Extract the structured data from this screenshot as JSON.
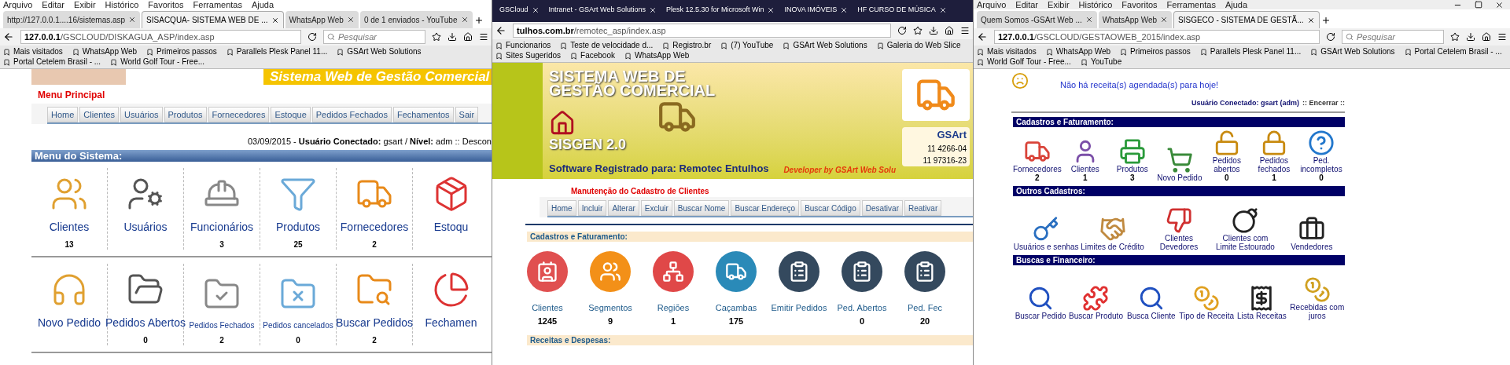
{
  "left": {
    "menu_bar": [
      "Arquivo",
      "Editar",
      "Exibir",
      "Histórico",
      "Favoritos",
      "Ferramentas",
      "Ajuda"
    ],
    "tabs": [
      {
        "label": "http://127.0.0.1....16/sistemas.asp",
        "selected": false
      },
      {
        "label": "SISACQUA- SISTEMA WEB DE ...",
        "selected": true
      },
      {
        "label": "WhatsApp Web",
        "selected": false
      },
      {
        "label": "0 de 1 enviados - YouTube",
        "selected": false
      }
    ],
    "address_host": "127.0.0.1",
    "address_path": "/GSCLOUD/DISKAGUA_ASP/index.asp",
    "search_placeholder": "Pesquisar",
    "bookmarks": [
      "Mais visitados",
      "WhatsApp Web",
      "Primeiros passos",
      "Parallels Plesk Panel 11...",
      "GSArt Web Solutions",
      "Portal Cetelem Brasil - ...",
      "World Golf Tour - Free..."
    ],
    "banner_text": "Sistema Web de Gestão Comercial",
    "menu_title": "Menu Principal",
    "nav": [
      "Home",
      "Clientes",
      "Usuários",
      "Produtos",
      "Fornecedores",
      "Estoque",
      "Pedidos Fechados",
      "Fechamentos",
      "Sair"
    ],
    "status": "03/09/2015 - **Usuário Conectado:** gsart / **Nível:** adm :: Descon",
    "section": "Menu do Sistema:",
    "rows": [
      [
        {
          "label": "Clientes",
          "count": "13"
        },
        {
          "label": "Usuários"
        },
        {
          "label": "Funcionários",
          "count": "3"
        },
        {
          "label": "Produtos",
          "count": "25"
        },
        {
          "label": "Fornecedores",
          "count": "2"
        },
        {
          "label": "Estoqu"
        }
      ],
      [
        {
          "label": "Novo Pedido"
        },
        {
          "label": "Pedidos Abertos",
          "count": "0"
        },
        {
          "label": "Pedidos Fechados",
          "count": "2"
        },
        {
          "label": "Pedidos cancelados",
          "count": "0"
        },
        {
          "label": "Buscar Pedidos",
          "count": "2"
        },
        {
          "label": "Fechamen"
        }
      ]
    ]
  },
  "middle": {
    "tabs": [
      {
        "label": "GSCloud",
        "selected": false
      },
      {
        "label": "Intranet - GSArt Web Solutions",
        "selected": false
      },
      {
        "label": "Plesk 12.5.30 for Microsoft Win",
        "selected": false
      },
      {
        "label": "INOVA IMÓVEIS",
        "selected": false
      },
      {
        "label": "HF CURSO DE MÚSICA",
        "selected": false
      }
    ],
    "address_host": "tulhos.com.br",
    "address_path": "/remotec_asp/index.asp",
    "bookmarks": [
      "Funcionarios",
      "Teste de velocidade d...",
      "Registro.br",
      "(7) YouTube",
      "GSArt Web Solutions",
      "Galeria do Web Slice",
      "Sites Sugeridos",
      "Facebook",
      "WhatsApp Web"
    ],
    "banner": {
      "title": "SISTEMA WEB DE GESTÃO COMERCIAL",
      "product": "SISGEN 2.0",
      "registered": "Software Registrado para: Remotec Entulhos",
      "developer": "Developer by GSArt Web Solu",
      "brand": "GSArt",
      "phones": [
        "11 4266-04",
        "11 97316-23"
      ]
    },
    "page_title": "Manutenção do Cadastro de Clientes",
    "nav": [
      "Home",
      "Incluir",
      "Alterar",
      "Excluir",
      "Buscar Nome",
      "Buscar Endereço",
      "Buscar Código",
      "Desativar",
      "Reativar"
    ],
    "section": "Cadastros e Faturamento:",
    "tiles": [
      {
        "label": "Clientes",
        "count": "1245"
      },
      {
        "label": "Segmentos",
        "count": "9"
      },
      {
        "label": "Regiões",
        "count": "1"
      },
      {
        "label": "Caçambas",
        "count": "175"
      },
      {
        "label": "Emitir Pedidos"
      },
      {
        "label": "Ped. Abertos",
        "count": "0"
      },
      {
        "label": "Ped. Fec",
        "count": "20"
      }
    ],
    "section_2": "Receitas e Despesas:"
  },
  "right": {
    "menu_bar": [
      "Arquivo",
      "Editar",
      "Exibir",
      "Histórico",
      "Favoritos",
      "Ferramentas",
      "Ajuda"
    ],
    "tabs": [
      {
        "label": "Quem Somos -GSArt Web ...",
        "selected": false
      },
      {
        "label": "WhatsApp Web",
        "selected": false
      },
      {
        "label": "SISGECO - SISTEMA DE GESTÃ...",
        "selected": true
      }
    ],
    "address_host": "127.0.0.1",
    "address_path": "/GSCLOUD/GESTAOWEB_2015/index.asp",
    "search_placeholder": "Pesquisar",
    "bookmarks": [
      "Mais visitados",
      "WhatsApp Web",
      "Primeiros passos",
      "Parallels Plesk Panel 11...",
      "GSArt Web Solutions",
      "Portal Cetelem Brasil - ...",
      "World Golf Tour - Free...",
      "YouTube"
    ],
    "notice": "Não há receita(s) agendada(s) para hoje!",
    "user": "Usuário Conectado: gsart (adm)",
    "logout": ":: Encerrar ::",
    "sections": [
      {
        "title": "Cadastros e Faturamento:",
        "tiles": [
          {
            "label": "Fornecedores",
            "count": "2"
          },
          {
            "label": "Clientes",
            "count": "1"
          },
          {
            "label": "Produtos",
            "count": "3"
          },
          {
            "label": "Novo Pedido"
          },
          {
            "label": "Pedidos abertos",
            "count": "0"
          },
          {
            "label": "Pedidos fechados",
            "count": "1"
          },
          {
            "label": "Ped. incompletos",
            "count": "0"
          }
        ]
      },
      {
        "title": "Outros Cadastros:",
        "tiles": [
          {
            "label": "Usuários e senhas"
          },
          {
            "label": "Limites de Crédito"
          },
          {
            "label": "Clientes Devedores"
          },
          {
            "label": "Clientes com Limite Estourado"
          },
          {
            "label": "Vendedores"
          }
        ]
      },
      {
        "title": "Buscas e Financeiro:",
        "tiles": [
          {
            "label": "Buscar Pedido"
          },
          {
            "label": "Buscar Produto"
          },
          {
            "label": "Busca Cliente"
          },
          {
            "label": "Tipo de Receita"
          },
          {
            "label": "Lista Receitas"
          },
          {
            "label": "Recebidas com juros"
          }
        ]
      }
    ]
  }
}
